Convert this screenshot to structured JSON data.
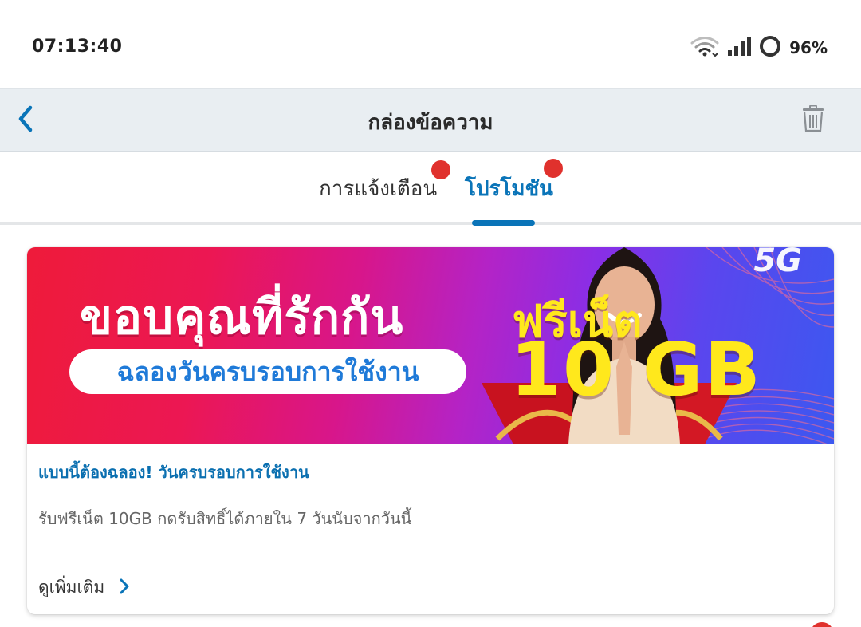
{
  "status_bar": {
    "time": "07:13:40",
    "battery_percent_text": "96%",
    "battery_level": 0.96,
    "icons": [
      "wifi-icon",
      "signal-icon",
      "battery-ring-icon"
    ]
  },
  "header": {
    "title": "กล่องข้อความ",
    "back_icon": "chevron-left-icon",
    "delete_icon": "trash-icon"
  },
  "tabs": [
    {
      "label": "การแจ้งเตือน",
      "active": false,
      "has_dot": true
    },
    {
      "label": "โปรโมชัน",
      "active": true,
      "has_dot": true
    }
  ],
  "promo_card": {
    "banner": {
      "headline": "ขอบคุณที่รักกัน",
      "pill_text": "ฉลองวันครบรอบการใช้งาน",
      "free_text": "ฟรีเน็ต",
      "amount_text": "10 GB",
      "badge_text": "5G"
    },
    "title": "แบบนี้ต้องฉลอง! วันครบรอบการใช้งาน",
    "description": "รับฟรีเน็ต 10GB กดรับสิทธิ์ได้ภายใน 7 วันนับจากวันนี้",
    "more_label": "ดูเพิ่มเติม",
    "more_icon": "chevron-right-icon"
  },
  "colors": {
    "accent": "#0a74b8",
    "dot": "#e0312d",
    "header_bg": "#e9eef2",
    "banner_yellow": "#ffe81c"
  }
}
